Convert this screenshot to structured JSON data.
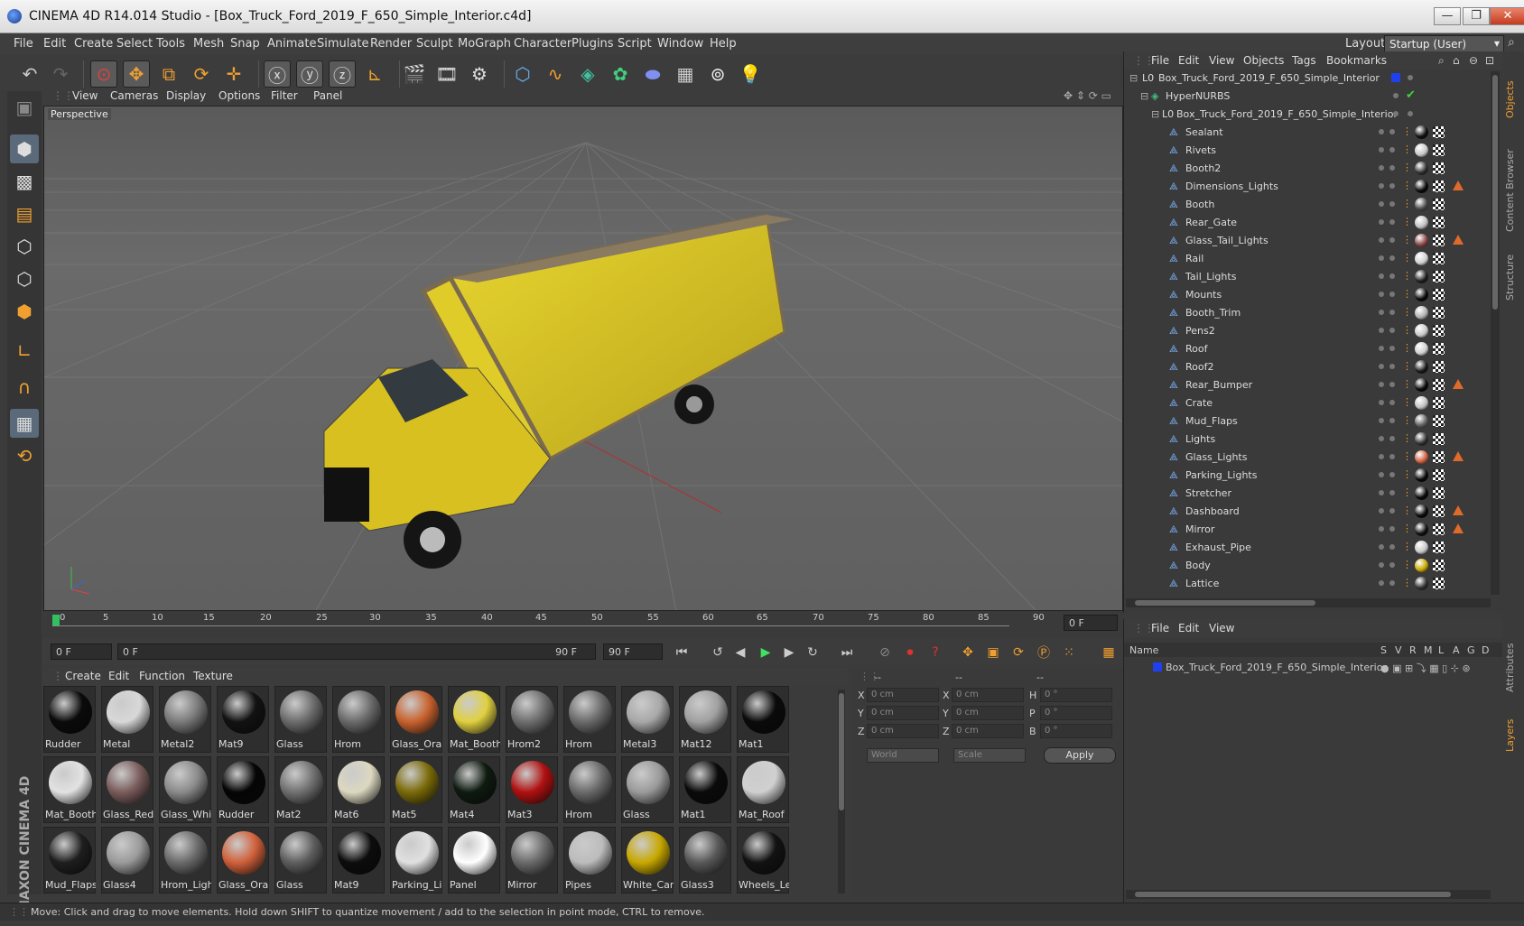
{
  "window": {
    "title": "CINEMA 4D R14.014 Studio - [Box_Truck_Ford_2019_F_650_Simple_Interior.c4d]",
    "min": "—",
    "max": "❐",
    "close": "✕"
  },
  "menubar": {
    "items": [
      "File",
      "Edit",
      "Create",
      "Select",
      "Tools",
      "Mesh",
      "Snap",
      "Animate",
      "Simulate",
      "Render",
      "Sculpt",
      "MoGraph",
      "Character",
      "Plugins",
      "Script",
      "Window",
      "Help"
    ],
    "layout_label": "Layout:",
    "layout_value": "Startup (User)"
  },
  "viewport": {
    "menu": [
      "View",
      "Cameras",
      "Display",
      "Options",
      "Filter",
      "Panel"
    ],
    "label": "Perspective"
  },
  "timeline": {
    "ticks": [
      "0",
      "5",
      "10",
      "15",
      "20",
      "25",
      "30",
      "35",
      "40",
      "45",
      "50",
      "55",
      "60",
      "65",
      "70",
      "75",
      "80",
      "85",
      "90"
    ],
    "current_frame": "0 F",
    "start_field": "0 F",
    "range_start": "0 F",
    "range_end": "90 F",
    "end_field": "90 F"
  },
  "materials": {
    "menu": [
      "Create",
      "Edit",
      "Function",
      "Texture"
    ],
    "items": [
      {
        "name": "Rudder",
        "color": "#0a0a0a"
      },
      {
        "name": "Metal",
        "color": "#d8d8d8"
      },
      {
        "name": "Metal2",
        "color": "#7a7a7a"
      },
      {
        "name": "Mat9",
        "color": "#121212"
      },
      {
        "name": "Glass",
        "color": "#6c6c6c"
      },
      {
        "name": "Hrom",
        "color": "#6a6a6a"
      },
      {
        "name": "Glass_Orar",
        "color": "#c8622e"
      },
      {
        "name": "Mat_Booth",
        "color": "#e0d040"
      },
      {
        "name": "Hrom2",
        "color": "#6e6e6e"
      },
      {
        "name": "Hrom",
        "color": "#6a6a6a"
      },
      {
        "name": "Metal3",
        "color": "#a8a8a8"
      },
      {
        "name": "Mat12",
        "color": "#a0a0a0"
      },
      {
        "name": "Mat1",
        "color": "#0a0a0a"
      },
      {
        "name": "Mat_Booth",
        "color": "#e2e2e2"
      },
      {
        "name": "Glass_Red",
        "color": "#7a5c5c"
      },
      {
        "name": "Glass_Whit",
        "color": "#8a8a8a"
      },
      {
        "name": "Rudder",
        "color": "#050505"
      },
      {
        "name": "Mat2",
        "color": "#707070"
      },
      {
        "name": "Mat6",
        "color": "#dcd8c0"
      },
      {
        "name": "Mat5",
        "color": "#7a6a08"
      },
      {
        "name": "Mat4",
        "color": "#0e1a10"
      },
      {
        "name": "Mat3",
        "color": "#b01010"
      },
      {
        "name": "Hrom",
        "color": "#6a6a6a"
      },
      {
        "name": "Glass",
        "color": "#9a9a9a"
      },
      {
        "name": "Mat1",
        "color": "#0a0a0a"
      },
      {
        "name": "Mat_Roof",
        "color": "#d0d0d0"
      },
      {
        "name": "Mud_Flaps",
        "color": "#1e1e1e"
      },
      {
        "name": "Glass4",
        "color": "#9a9a9a"
      },
      {
        "name": "Hrom_Ligh",
        "color": "#6a6a6a"
      },
      {
        "name": "Glass_Orar",
        "color": "#d0603a"
      },
      {
        "name": "Glass",
        "color": "#5e5e5e"
      },
      {
        "name": "Mat9",
        "color": "#0c0c0c"
      },
      {
        "name": "Parking_Lic",
        "color": "#e0e0e0"
      },
      {
        "name": "Panel",
        "color": "#ffffff"
      },
      {
        "name": "Mirror",
        "color": "#6a6a6a"
      },
      {
        "name": "Pipes",
        "color": "#bcbcbc"
      },
      {
        "name": "White_Car",
        "color": "#c8a800"
      },
      {
        "name": "Glass3",
        "color": "#585858"
      },
      {
        "name": "Wheels_Lel",
        "color": "#121212"
      }
    ]
  },
  "attributes": {
    "header": [
      "--",
      "--",
      "--"
    ],
    "rows": [
      {
        "l1": "X",
        "v1": "0 cm",
        "l2": "X",
        "v2": "0 cm",
        "l3": "H",
        "v3": "0 °"
      },
      {
        "l1": "Y",
        "v1": "0 cm",
        "l2": "Y",
        "v2": "0 cm",
        "l3": "P",
        "v3": "0 °"
      },
      {
        "l1": "Z",
        "v1": "0 cm",
        "l2": "Z",
        "v2": "0 cm",
        "l3": "B",
        "v3": "0 °"
      }
    ],
    "coord_select": "World",
    "scale_select": "Scale",
    "apply": "Apply"
  },
  "status": "Move: Click and drag to move elements. Hold down SHIFT to quantize movement / add to the selection in point mode, CTRL to remove.",
  "objects": {
    "menu": [
      "File",
      "Edit",
      "View",
      "Objects",
      "Tags",
      "Bookmarks"
    ],
    "root": "Box_Truck_Ford_2019_F_650_Simple_Interior",
    "hypernurbs": "HyperNURBS",
    "child": "Box_Truck_Ford_2019_F_650_Simple_Interior",
    "items": [
      "Sealant",
      "Rivets",
      "Booth2",
      "Dimensions_Lights",
      "Booth",
      "Rear_Gate",
      "Glass_Tail_Lights",
      "Rail",
      "Tail_Lights",
      "Mounts",
      "Booth_Trim",
      "Pens2",
      "Roof",
      "Roof2",
      "Rear_Bumper",
      "Crate",
      "Mud_Flaps",
      "Lights",
      "Glass_Lights",
      "Parking_Lights",
      "Stretcher",
      "Dashboard",
      "Mirror",
      "Exhaust_Pipe",
      "Body",
      "Lattice"
    ]
  },
  "layers": {
    "menu": [
      "File",
      "Edit",
      "View"
    ],
    "columns": [
      "Name",
      "S",
      "V",
      "R",
      "M",
      "L",
      "A",
      "G",
      "D"
    ],
    "row": "Box_Truck_Ford_2019_F_650_Simple_Interior"
  },
  "right_tabs": [
    "Objects",
    "Content Browser",
    "Structure",
    "Attributes",
    "Layers"
  ],
  "logo": "MAXON CINEMA 4D"
}
